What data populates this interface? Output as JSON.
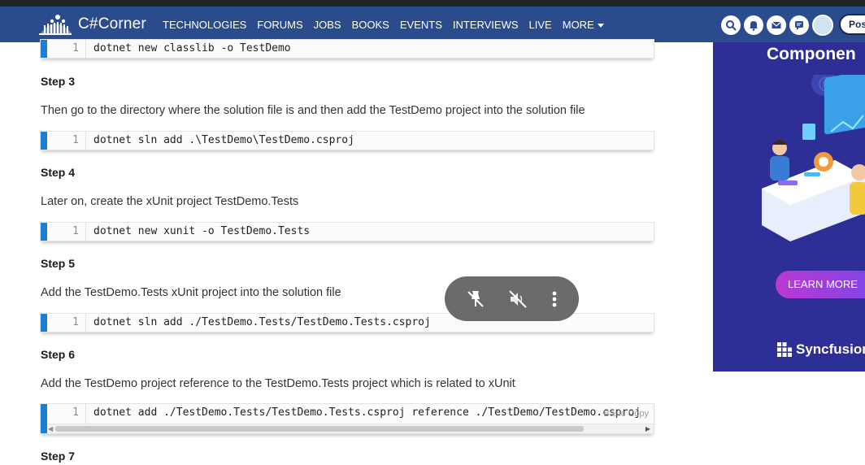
{
  "header": {
    "logo_text": "C#Corner",
    "nav": [
      "TECHNOLOGIES",
      "FORUMS",
      "JOBS",
      "BOOKS",
      "EVENTS",
      "INTERVIEWS",
      "LIVE",
      "MORE"
    ],
    "post_label": "Pos",
    "icons": [
      "search-icon",
      "bell-icon",
      "mail-icon",
      "chat-icon",
      "avatar"
    ]
  },
  "article": {
    "steps": [
      {
        "label": "Step 3",
        "text": "Then go to the directory where the solution file is and then add the TestDemo project into the solution file",
        "code": "dotnet sln add .\\TestDemo\\TestDemo.csproj"
      },
      {
        "label": "Step 4",
        "text": "Later on, create the xUnit project TestDemo.Tests",
        "code": "dotnet new xunit -o TestDemo.Tests"
      },
      {
        "label": "Step 5",
        "text": "Add the TestDemo.Tests xUnit project into the solution file",
        "code": "dotnet sln add ./TestDemo.Tests/TestDemo.Tests.csproj"
      },
      {
        "label": "Step 6",
        "text": "Add the TestDemo project reference to the TestDemo.Tests project which is related to xUnit",
        "code": "dotnet add ./TestDemo.Tests/TestDemo.Tests.csproj reference ./TestDemo/TestDemo.csproj"
      },
      {
        "label": "Step 7"
      }
    ],
    "first_code": "dotnet new classlib -o TestDemo",
    "line_number": "1",
    "code_tools": "Basic  Copy"
  },
  "ad": {
    "title": "Componen",
    "button": "LEARN MORE",
    "brand": "Syncfusion",
    "colors": {
      "background": "#2d2e96",
      "button": "#9b3fdc"
    }
  },
  "media_overlay": {
    "icons": [
      "unpin-icon",
      "mute-icon",
      "more-vertical-icon"
    ]
  }
}
